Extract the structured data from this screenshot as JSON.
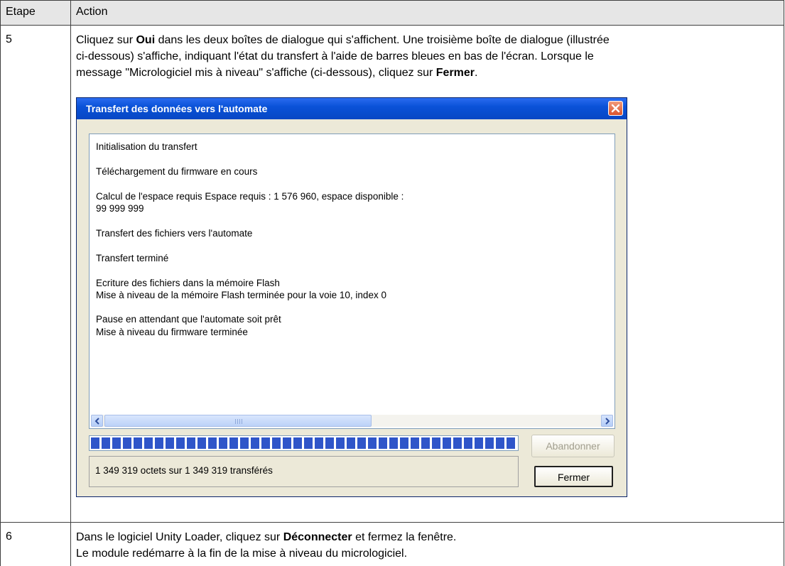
{
  "table": {
    "headers": [
      "Etape",
      "Action"
    ],
    "rows": [
      {
        "step": "5",
        "lines": [
          [
            "Cliquez sur ",
            {
              "b": "Oui"
            },
            " dans les deux boîtes de dialogue qui s'affichent. Une troisième boîte de dialogue (illustrée"
          ],
          [
            "ci-dessous) s'affiche, indiquant l'état du transfert à l'aide de barres bleues en bas de l'écran. Lorsque le"
          ],
          [
            "message \"Micrologiciel mis à niveau\" s'affiche (ci-dessous), cliquez sur ",
            {
              "b": "Fermer"
            },
            "."
          ]
        ]
      },
      {
        "step": "6",
        "lines": [
          [
            "Dans le logiciel Unity Loader, cliquez sur ",
            {
              "b": "Déconnecter"
            },
            " et fermez la fenêtre."
          ],
          [
            "Le module redémarre à la fin de la mise à niveau du micrologiciel."
          ]
        ]
      }
    ]
  },
  "dialog": {
    "title": "Transfert des données vers l'automate",
    "log_lines": [
      "Initialisation du transfert",
      "Téléchargement du firmware en cours",
      "Calcul de l'espace requis Espace requis : 1 576 960, espace disponible :",
      "99 999 999",
      "Transfert des fichiers vers l'automate",
      "Transfert terminé",
      "Ecriture des fichiers dans la mémoire Flash",
      "Mise à niveau de la mémoire Flash terminée pour la voie 10, index 0",
      " Pause en attendant que l'automate soit prêt",
      " Mise à niveau du firmware terminée"
    ],
    "progress_fraction": 1.0,
    "status_text": "1 349 319 octets sur 1 349 319 transférés",
    "abort_label": "Abandonner",
    "close_label": "Fermer",
    "colors": {
      "title_bar": "#0a52d8",
      "progress": "#2f55c9",
      "close_button": "#d9532c"
    }
  }
}
